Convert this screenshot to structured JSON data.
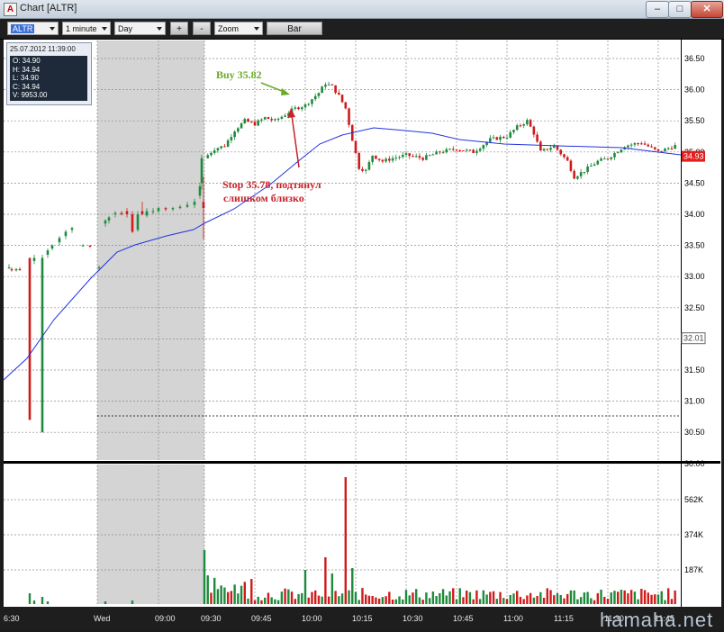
{
  "window": {
    "title": "Chart [ALTR]",
    "minimize": "–",
    "maximize": "□",
    "close": "✕"
  },
  "toolbar": {
    "symbol": "ALTR",
    "interval": "1 minute",
    "period": "Day",
    "plus_label": "+",
    "minus_label": "-",
    "zoom": "Zoom",
    "bar_label": "Bar"
  },
  "ohlc_box": {
    "datetime": "25.07.2012 11:39:00",
    "open": "O: 34.90",
    "high": "H: 34.94",
    "low": "L: 34.90",
    "close": "C: 34.94",
    "volume": "V: 9953.00"
  },
  "annotations": {
    "buy": "Buy 35.82",
    "stop_line1": "Stop 35.78, подтянул",
    "stop_line2": "слишком близко"
  },
  "price_axis": {
    "labels": [
      "36.50",
      "36.00",
      "35.50",
      "35.00",
      "34.50",
      "34.00",
      "33.50",
      "33.00",
      "32.50",
      "32.00",
      "31.50",
      "31.00",
      "30.50",
      "30.00"
    ],
    "current_price": "34.93",
    "marker_price": "32.01"
  },
  "volume_axis": {
    "labels": [
      "562K",
      "374K",
      "187K"
    ]
  },
  "time_axis": {
    "labels": [
      "6:30",
      "Wed",
      "09:00",
      "09:30",
      "09:45",
      "10:00",
      "10:15",
      "10:30",
      "10:45",
      "11:00",
      "11:15",
      "11:30",
      "11:45"
    ]
  },
  "watermark": "hamaha.net",
  "colors": {
    "up": "#1e8a3c",
    "down": "#d01b1b",
    "ma": "#2233dd",
    "premarket": "#d4d4d4"
  },
  "chart_data": {
    "type": "candlestick",
    "symbol": "ALTR",
    "interval": "1 minute",
    "ylim": [
      30.0,
      36.7
    ],
    "moving_average": [
      {
        "t": "06:30",
        "v": 31.25
      },
      {
        "t": "07:30",
        "v": 32.2
      },
      {
        "t": "08:30",
        "v": 33.45
      },
      {
        "t": "09:00",
        "v": 33.6
      },
      {
        "t": "09:30",
        "v": 33.85
      },
      {
        "t": "09:40",
        "v": 34.2
      },
      {
        "t": "09:50",
        "v": 34.6
      },
      {
        "t": "10:00",
        "v": 34.85
      },
      {
        "t": "10:05",
        "v": 35.05
      },
      {
        "t": "10:15",
        "v": 35.25
      },
      {
        "t": "10:20",
        "v": 35.35
      },
      {
        "t": "10:30",
        "v": 35.3
      },
      {
        "t": "10:45",
        "v": 35.15
      },
      {
        "t": "11:00",
        "v": 35.08
      },
      {
        "t": "11:15",
        "v": 35.04
      },
      {
        "t": "11:30",
        "v": 35.03
      },
      {
        "t": "11:45",
        "v": 34.95
      }
    ],
    "volume_bars_note": "visible volume spike near 10:09 (~900K)"
  }
}
